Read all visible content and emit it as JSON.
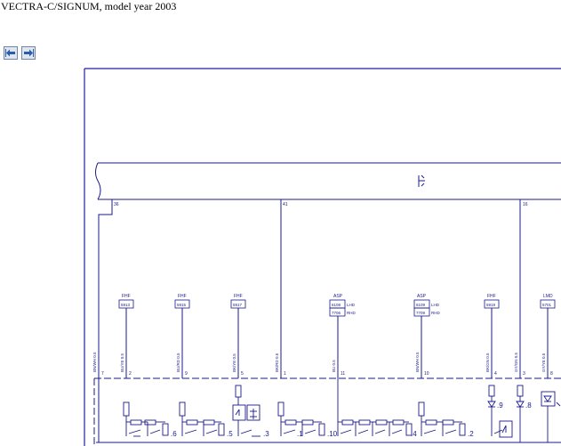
{
  "header": {
    "title": "VECTRA-C/SIGNUM, model year 2003"
  },
  "nav": {
    "back_icon": "arrow-left-icon",
    "forward_icon": "arrow-right-icon"
  },
  "colors": {
    "wire": "#1a1a8c",
    "frame": "#1f1fa8",
    "button_bg": "#dfe6ef",
    "button_border": "#6f87a8"
  },
  "diagram": {
    "bus_pins": {
      "left": "36",
      "mid": "41",
      "right": "16"
    },
    "connectors": [
      {
        "label": "FHF",
        "code": "5913"
      },
      {
        "label": "FHF",
        "code": "5915"
      },
      {
        "label": "FHF",
        "code": "5917"
      },
      {
        "label": "ASP",
        "code": "6108",
        "code2": "7706",
        "tag": "LHD",
        "tag2": "RHD"
      },
      {
        "label": "ASP",
        "code": "6109",
        "code2": "7709",
        "tag": "LHD",
        "tag2": "RHD"
      },
      {
        "label": "FHF",
        "code": "5919"
      },
      {
        "label": "LMD",
        "code": "5701"
      }
    ],
    "wire_labels": [
      "BN/WH 0.5",
      "BU/YE 0.5",
      "BU/RD 0.5",
      "BK/YE 0.5",
      "BK/RD 0.5",
      "BU 0.5",
      "BN/WH 0.5",
      "BK/GN 0.5",
      "GY/GN 0.5",
      "GY/YE 0.5"
    ],
    "pin_numbers": [
      "7",
      "2",
      "9",
      "5",
      "1",
      "11",
      "10",
      "4",
      "3",
      "8"
    ],
    "switch_labels": [
      ".6",
      ".5",
      ".3",
      ".1",
      ".10",
      ".4",
      ".2",
      ".9",
      ".8"
    ]
  }
}
